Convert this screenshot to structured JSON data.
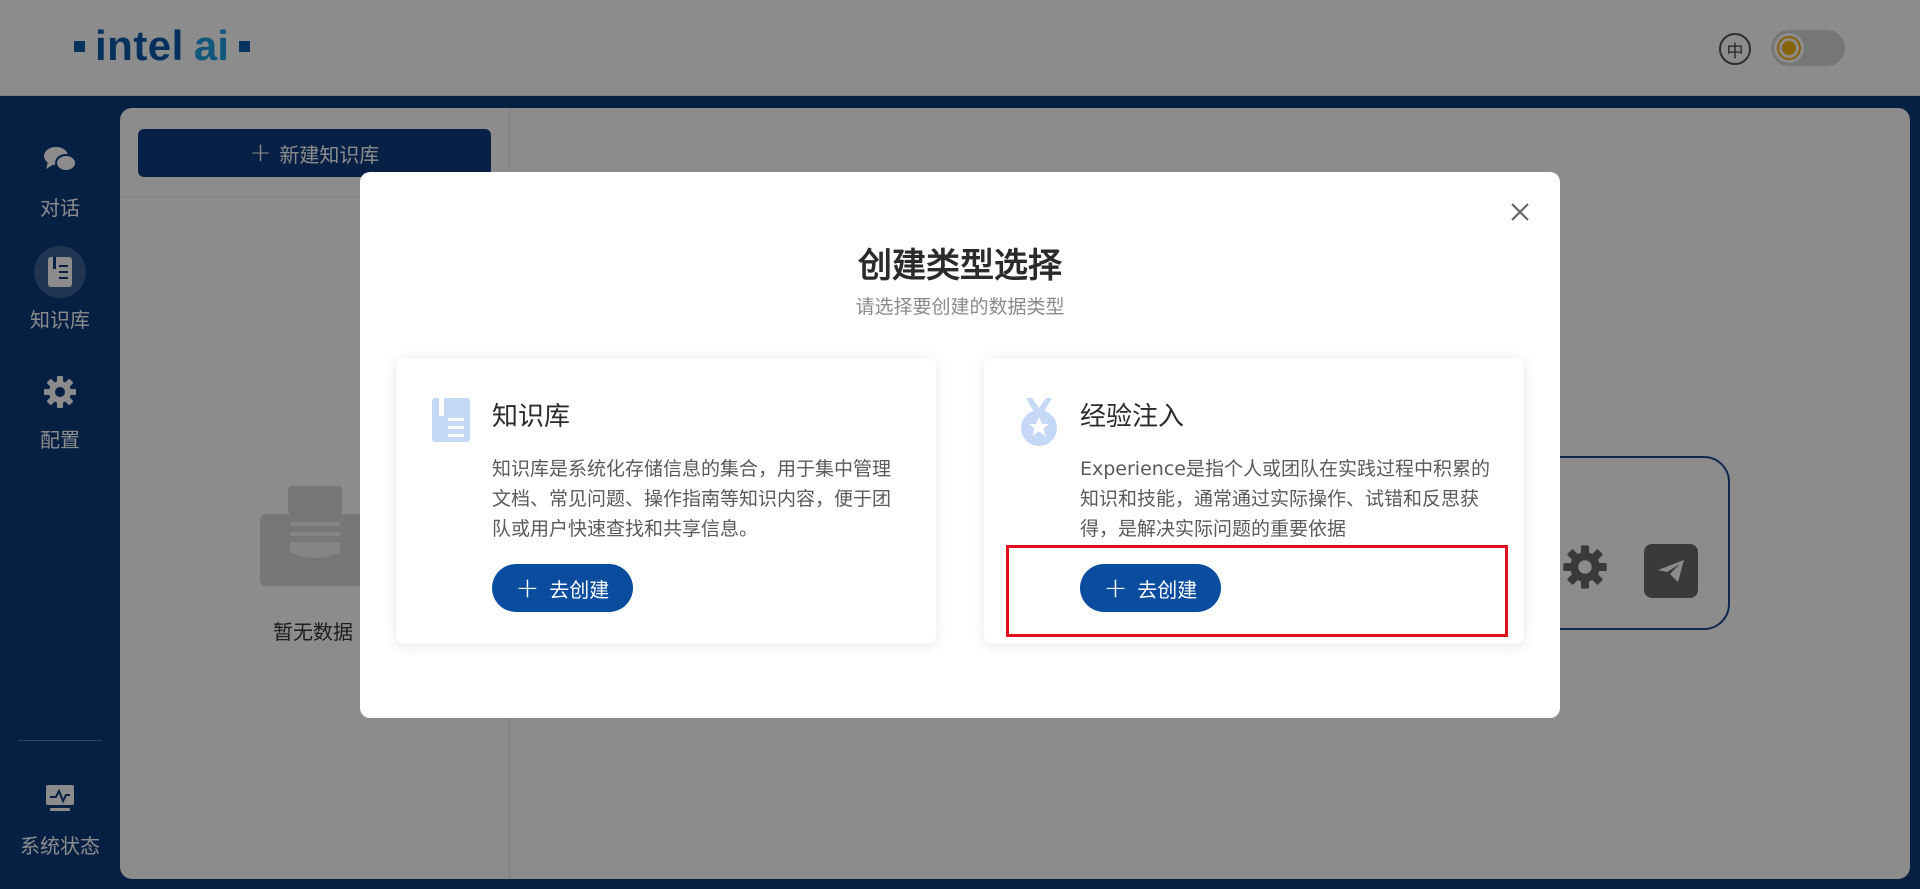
{
  "header": {
    "logo_text_1": "intel",
    "logo_text_2": "ai",
    "lang_label": "中"
  },
  "leftnav": {
    "items": [
      {
        "label": "对话",
        "icon": "chat-bubbles-icon",
        "active": false
      },
      {
        "label": "知识库",
        "icon": "book-icon",
        "active": true
      },
      {
        "label": "配置",
        "icon": "gear-icon",
        "active": false
      }
    ],
    "bottom_item": {
      "label": "系统状态",
      "icon": "monitor-icon"
    }
  },
  "kb_panel": {
    "new_button_label": "新建知识库",
    "empty_text": "暂无数据"
  },
  "modal": {
    "title": "创建类型选择",
    "subtitle": "请选择要创建的数据类型",
    "cards": [
      {
        "title": "知识库",
        "description": "知识库是系统化存储信息的集合，用于集中管理文档、常见问题、操作指南等知识内容，便于团队或用户快速查找和共享信息。",
        "button_label": "去创建",
        "icon": "document-icon"
      },
      {
        "title": "经验注入",
        "description": "Experience是指个人或团队在实践过程中积累的知识和技能，通常通过实际操作、试错和反思获得，是解决实际问题的重要依据",
        "button_label": "去创建",
        "icon": "medal-icon"
      }
    ]
  },
  "colors": {
    "nav_bg": "#0b3b7b",
    "primary_button": "#0a4d9e",
    "highlight_border": "#e0101e",
    "icon_light_blue": "#c5d8f5"
  }
}
